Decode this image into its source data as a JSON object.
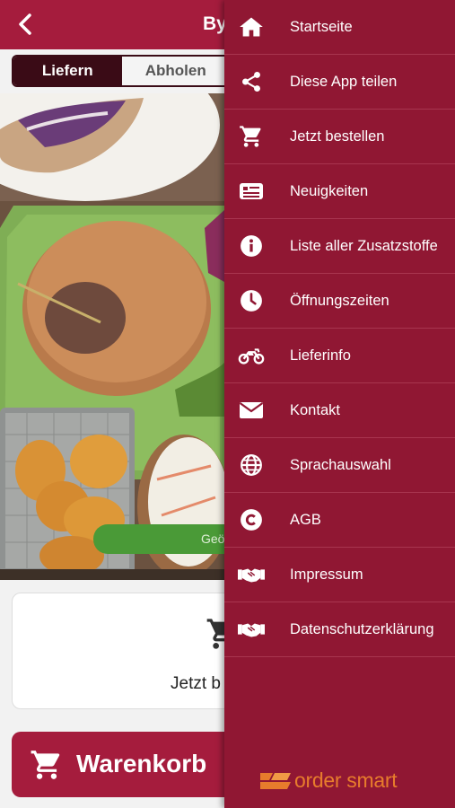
{
  "header": {
    "title": "Byl"
  },
  "tabs": {
    "deliver": "Liefern",
    "pickup": "Abholen"
  },
  "banner": {
    "text": "Geö"
  },
  "order_card": {
    "label": "Jetzt b"
  },
  "cart_button": {
    "label": "Warenkorb"
  },
  "drawer": {
    "items": [
      {
        "label": "Startseite",
        "icon": "home-icon"
      },
      {
        "label": "Diese App teilen",
        "icon": "share-icon"
      },
      {
        "label": "Jetzt bestellen",
        "icon": "cart-icon"
      },
      {
        "label": "Neuigkeiten",
        "icon": "news-icon"
      },
      {
        "label": "Liste aller Zusatzstoffe",
        "icon": "info-icon"
      },
      {
        "label": "Öffnungszeiten",
        "icon": "clock-icon"
      },
      {
        "label": "Lieferinfo",
        "icon": "motorcycle-icon"
      },
      {
        "label": "Kontakt",
        "icon": "envelope-icon"
      },
      {
        "label": "Sprachauswahl",
        "icon": "globe-icon"
      },
      {
        "label": "AGB",
        "icon": "copyright-icon"
      },
      {
        "label": "Impressum",
        "icon": "handshake-icon"
      },
      {
        "label": "Datenschutzerklärung",
        "icon": "handshake-icon"
      }
    ],
    "brand": "order smart"
  },
  "colors": {
    "primary": "#a51c3d",
    "drawer": "#901733",
    "segment_active": "#3a0b16",
    "geo_bar": "#4a9a37",
    "brand": "#e77c2c"
  }
}
